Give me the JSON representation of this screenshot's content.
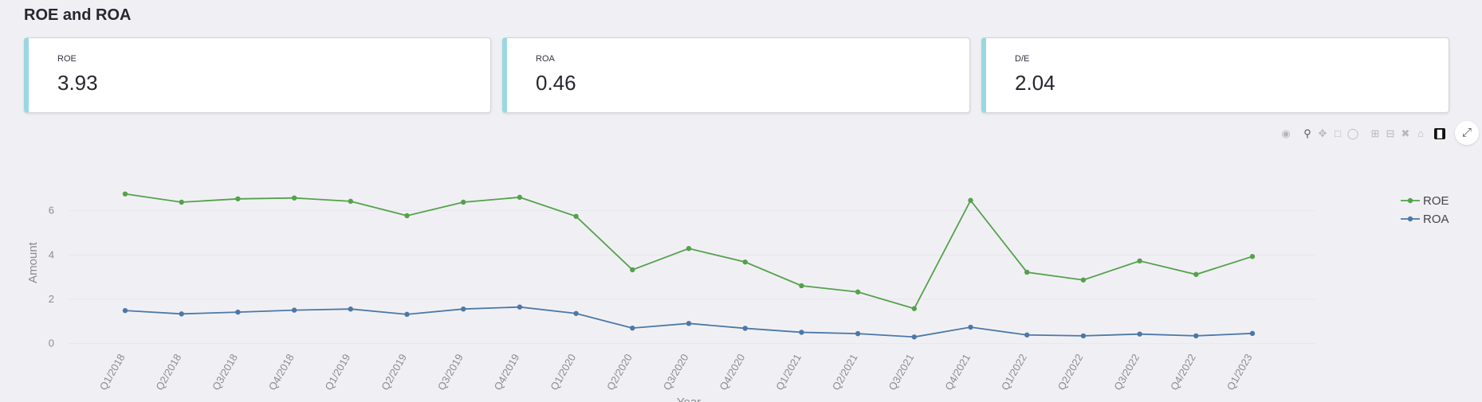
{
  "page": {
    "title": "ROE and ROA"
  },
  "metrics": [
    {
      "label": "ROE",
      "value": "3.93"
    },
    {
      "label": "ROA",
      "value": "0.46"
    },
    {
      "label": "D/E",
      "value": "2.04"
    }
  ],
  "toolbar": {
    "icons": [
      "camera-icon",
      "zoom-icon",
      "pan-icon",
      "box-select-icon",
      "lasso-select-icon",
      "zoom-in-icon",
      "zoom-out-icon",
      "autoscale-icon",
      "reset-axes-icon",
      "plotly-logo-icon"
    ],
    "expand_icon": "fullscreen-icon"
  },
  "chart_data": {
    "type": "line",
    "xlabel": "Year",
    "ylabel": "Amount",
    "categories": [
      "Q1/2018",
      "Q2/2018",
      "Q3/2018",
      "Q4/2018",
      "Q1/2019",
      "Q2/2019",
      "Q3/2019",
      "Q4/2019",
      "Q1/2020",
      "Q2/2020",
      "Q3/2020",
      "Q4/2020",
      "Q1/2021",
      "Q2/2021",
      "Q3/2021",
      "Q4/2021",
      "Q1/2022",
      "Q2/2022",
      "Q3/2022",
      "Q4/2022",
      "Q1/2023"
    ],
    "ylim": [
      -0.3,
      7.6
    ],
    "yticks": [
      0,
      2,
      4,
      6
    ],
    "grid": true,
    "legend": "top-right",
    "series": [
      {
        "name": "ROE",
        "color": "#54a24b",
        "values": [
          6.75,
          6.38,
          6.53,
          6.57,
          6.42,
          5.77,
          6.38,
          6.6,
          5.74,
          3.33,
          4.29,
          3.68,
          2.61,
          2.33,
          1.58,
          6.46,
          3.22,
          2.87,
          3.73,
          3.12,
          3.93
        ]
      },
      {
        "name": "ROA",
        "color": "#4c78a8",
        "values": [
          1.49,
          1.34,
          1.42,
          1.51,
          1.56,
          1.32,
          1.56,
          1.65,
          1.36,
          0.7,
          0.91,
          0.69,
          0.51,
          0.45,
          0.3,
          0.74,
          0.39,
          0.35,
          0.43,
          0.35,
          0.46
        ]
      }
    ]
  }
}
